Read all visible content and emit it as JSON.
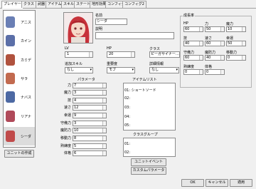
{
  "tabs": [
    "プレイヤー",
    "クラス",
    "武器",
    "アイテム",
    "スキル",
    "ステート",
    "地形効果",
    "コンフィグ",
    "コンフィグ2"
  ],
  "characters": [
    {
      "name": "アニス",
      "color": "#6a7fb5"
    },
    {
      "name": "カイン",
      "color": "#5b6fa8"
    },
    {
      "name": "カミデ",
      "color": "#b0523e"
    },
    {
      "name": "サラ",
      "color": "#c26a4f"
    },
    {
      "name": "ナバス",
      "color": "#4d69a3"
    },
    {
      "name": "リアナ",
      "color": "#b04a5a"
    },
    {
      "name": "シーダ",
      "color": "#c04a4a"
    }
  ],
  "create_unit_button": "ユニットの作成",
  "name": {
    "label": "名前",
    "value": "シーダ"
  },
  "description": {
    "label": "説明",
    "value": ""
  },
  "lv": {
    "label": "LV",
    "value": "1"
  },
  "hp": {
    "label": "HP",
    "value": "20"
  },
  "class": {
    "label": "クラス",
    "value": "ピーガサイナー…"
  },
  "extra_skill": {
    "label": "追加スキル",
    "value": "なし"
  },
  "importance": {
    "label": "重要度",
    "value": "モブ"
  },
  "detail_info": {
    "label": "詳細情報",
    "value": "なし"
  },
  "params": {
    "title": "パラメータ",
    "rows": [
      {
        "label": "力",
        "value": "7"
      },
      {
        "label": "魔力",
        "value": "3"
      },
      {
        "label": "技",
        "value": "4"
      },
      {
        "label": "速さ",
        "value": "12"
      },
      {
        "label": "幸運",
        "value": "9"
      },
      {
        "label": "守備力",
        "value": "3"
      },
      {
        "label": "魔防力",
        "value": "10"
      },
      {
        "label": "移動力",
        "value": "8"
      },
      {
        "label": "熟練度",
        "value": "5"
      },
      {
        "label": "体格",
        "value": "6"
      }
    ]
  },
  "item_list": {
    "title": "アイテムリスト",
    "items": [
      "01: ショートソード",
      "02:",
      "03:",
      "04:",
      "05:"
    ]
  },
  "class_group": {
    "title": "クラスグループ",
    "items": [
      "01:",
      "02:"
    ]
  },
  "unit_event_button": "ユニットイベント",
  "custom_param_button": "カスタムパラメータ",
  "growth": {
    "title": "成長率",
    "fields": [
      {
        "label": "HP",
        "value": "60"
      },
      {
        "label": "力",
        "value": "50"
      },
      {
        "label": "魔力",
        "value": "10"
      },
      {
        "label": "技",
        "value": "40"
      },
      {
        "label": "速さ",
        "value": "60"
      },
      {
        "label": "幸運",
        "value": "50"
      },
      {
        "label": "守備力",
        "value": "60"
      },
      {
        "label": "魔防力",
        "value": "40"
      },
      {
        "label": "移動力",
        "value": "0"
      },
      {
        "label": "熟練度",
        "value": "0"
      },
      {
        "label": "体格",
        "value": "0"
      }
    ]
  },
  "footer": {
    "ok": "OK",
    "cancel": "キャンセル",
    "apply": "適用"
  }
}
